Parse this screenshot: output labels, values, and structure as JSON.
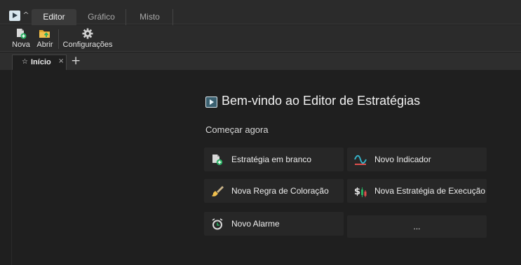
{
  "ribbon": {
    "tabs": [
      {
        "label": "Editor",
        "active": true
      },
      {
        "label": "Gráfico",
        "active": false
      },
      {
        "label": "Misto",
        "active": false
      }
    ],
    "collapse_glyph": "^"
  },
  "toolbar": {
    "nova_label": "Nova",
    "abrir_label": "Abrir",
    "config_label": "Configurações"
  },
  "doc_tabs": {
    "active": {
      "star": "☆",
      "label": "Início",
      "close": "×"
    },
    "add": "+"
  },
  "welcome": {
    "title": "Bem-vindo ao Editor de Estratégias",
    "subtitle": "Começar agora"
  },
  "actions": [
    {
      "label": "Estratégia em branco",
      "icon": "new-document-icon"
    },
    {
      "label": "Novo Indicador",
      "icon": "indicator-wave-icon"
    },
    {
      "label": "Nova Regra de Coloração",
      "icon": "paint-brush-icon"
    },
    {
      "label": "Nova Estratégia de Execução",
      "icon": "dollar-candles-icon"
    },
    {
      "label": "Novo Alarme",
      "icon": "alarm-clock-icon"
    },
    {
      "label": "...",
      "icon": ""
    }
  ],
  "colors": {
    "background": "#1f1f1f",
    "ribbon": "#2b2b2b",
    "card": "#272727",
    "accent_green": "#27ae60",
    "accent_red": "#e0504e",
    "accent_teal": "#35b3c9"
  }
}
